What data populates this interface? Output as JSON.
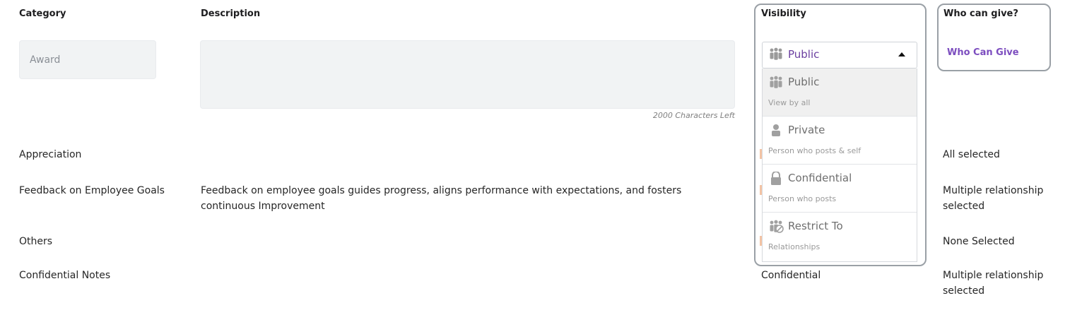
{
  "headers": {
    "category": "Category",
    "description": "Description",
    "visibility": "Visibility",
    "who_can_give": "Who can give?"
  },
  "edit_row": {
    "category_value": "Award",
    "description_value": "",
    "chars_left": "2000 Characters Left",
    "visibility_selected": "Public",
    "who_can_give_link": "Who Can Give"
  },
  "visibility_options": [
    {
      "label": "Public",
      "sub": "View by all",
      "icon": "people-group-icon"
    },
    {
      "label": "Private",
      "sub": "Person who posts & self",
      "icon": "person-icon"
    },
    {
      "label": "Confidential",
      "sub": "Person who posts",
      "icon": "lock-icon"
    },
    {
      "label": "Restrict To",
      "sub": "Relationships",
      "icon": "restricted-group-icon"
    }
  ],
  "rows": [
    {
      "category": "Appreciation",
      "description": "",
      "visibility": "",
      "who_can_give": "All selected"
    },
    {
      "category": "Feedback on Employee Goals",
      "description": "Feedback on employee goals guides progress, aligns performance with expectations, and fosters continuous Improvement",
      "visibility": "",
      "who_can_give": "Multiple relationship selected"
    },
    {
      "category": "Others",
      "description": "",
      "visibility": "",
      "who_can_give": "None Selected"
    },
    {
      "category": "Confidential Notes",
      "description": "",
      "visibility": "Confidential",
      "who_can_give": "Multiple relationship selected"
    }
  ],
  "colors": {
    "accent_purple": "#6b3fa0",
    "highlight_border": "#9aa0a6",
    "input_bg": "#f1f3f4"
  }
}
